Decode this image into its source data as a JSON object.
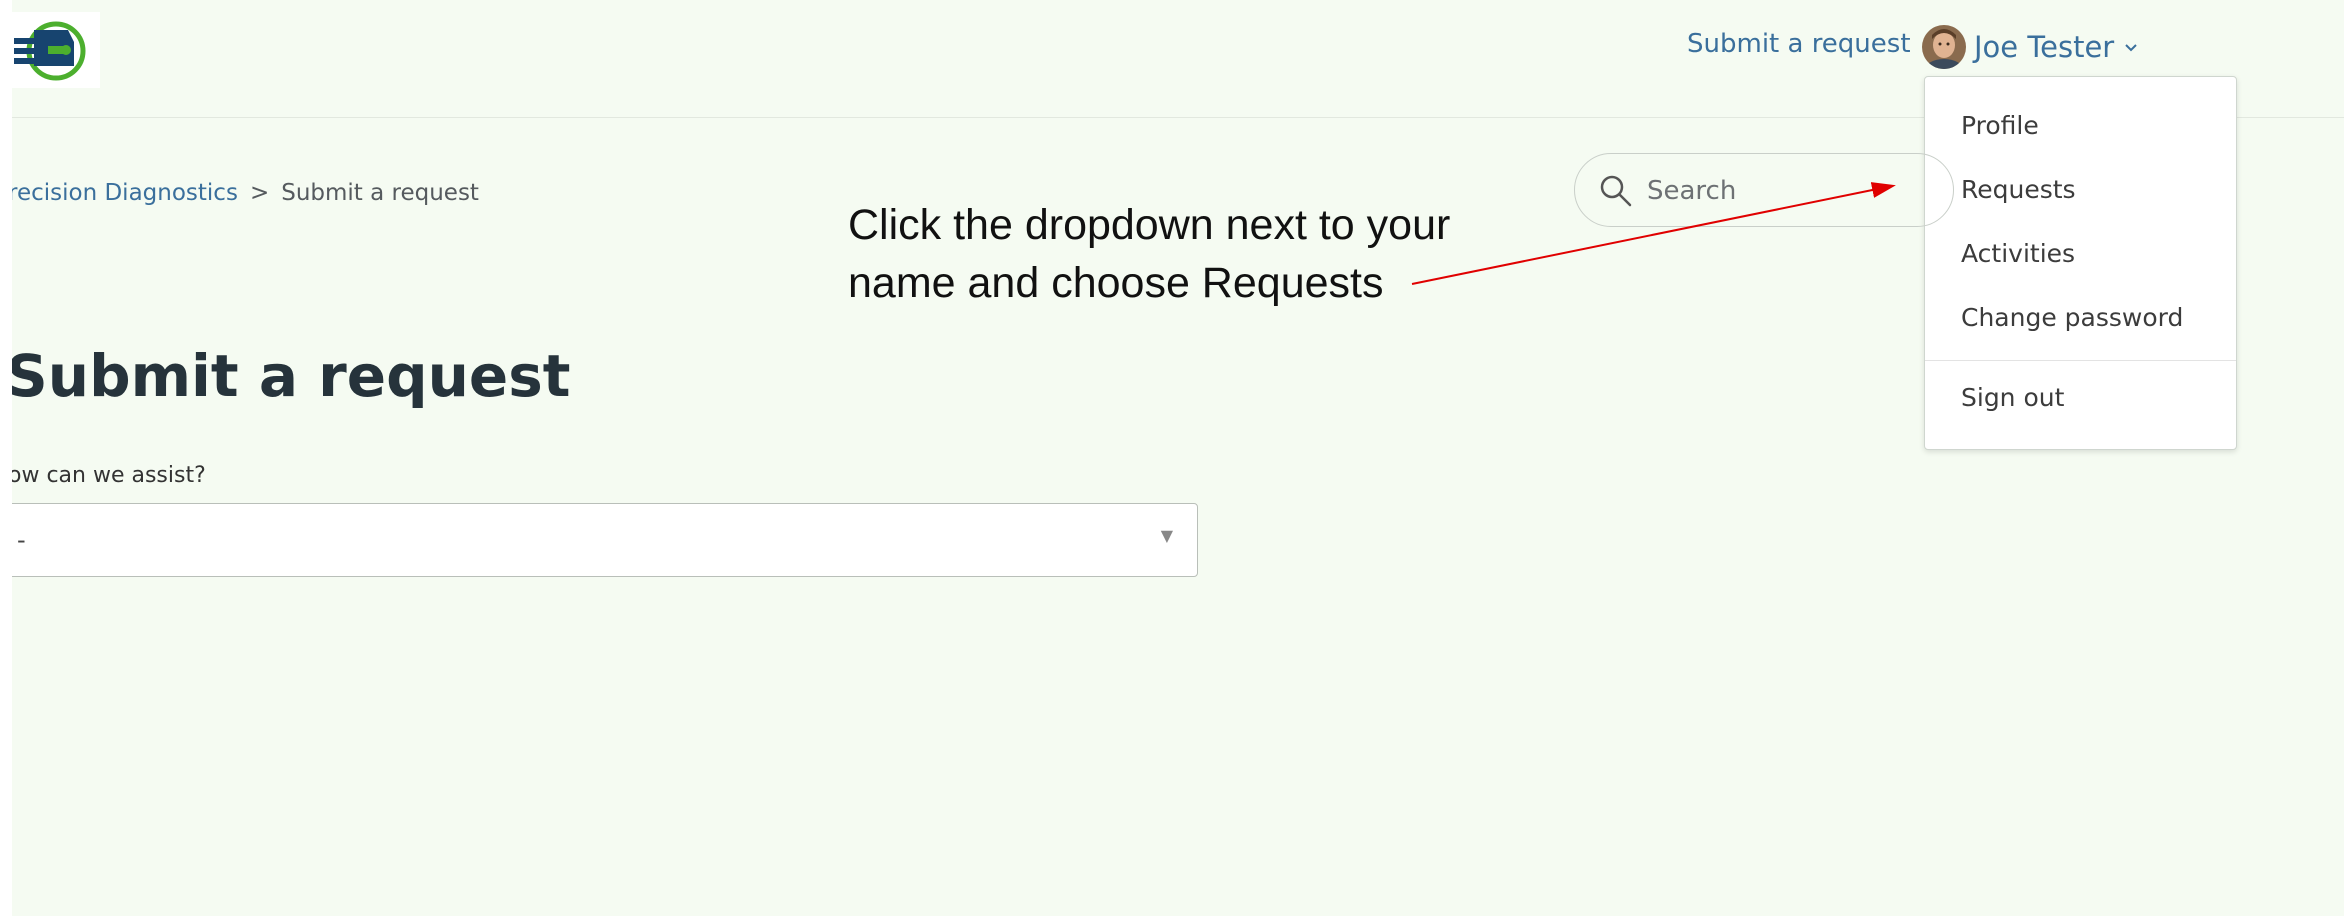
{
  "header": {
    "logo_icon": "car-diagnostics-logo-icon",
    "nav_submit_label": "Submit a request",
    "user_name": "Joe Tester",
    "avatar_icon": "user-avatar",
    "chevron_icon": "chevron-down-icon"
  },
  "user_menu": {
    "items": [
      "Profile",
      "Requests",
      "Activities",
      "Change password",
      "Sign out"
    ]
  },
  "breadcrumb": {
    "home": "recision Diagnostics",
    "separator": ">",
    "current": "Submit a request"
  },
  "search": {
    "placeholder": "Search",
    "icon": "search-icon"
  },
  "annotation": {
    "line1": "Click the dropdown next to your",
    "line2": "name and choose Requests",
    "color": "#e00000"
  },
  "form": {
    "title": "Submit a request",
    "assist_label": "ow can we assist?",
    "assist_value": "-",
    "caret_glyph": "▼"
  },
  "colors": {
    "page_background": "#f5fbf2",
    "link": "#3a6f9c",
    "logo_blue": "#17446f",
    "logo_green": "#4caf2e",
    "title": "#26333b"
  }
}
